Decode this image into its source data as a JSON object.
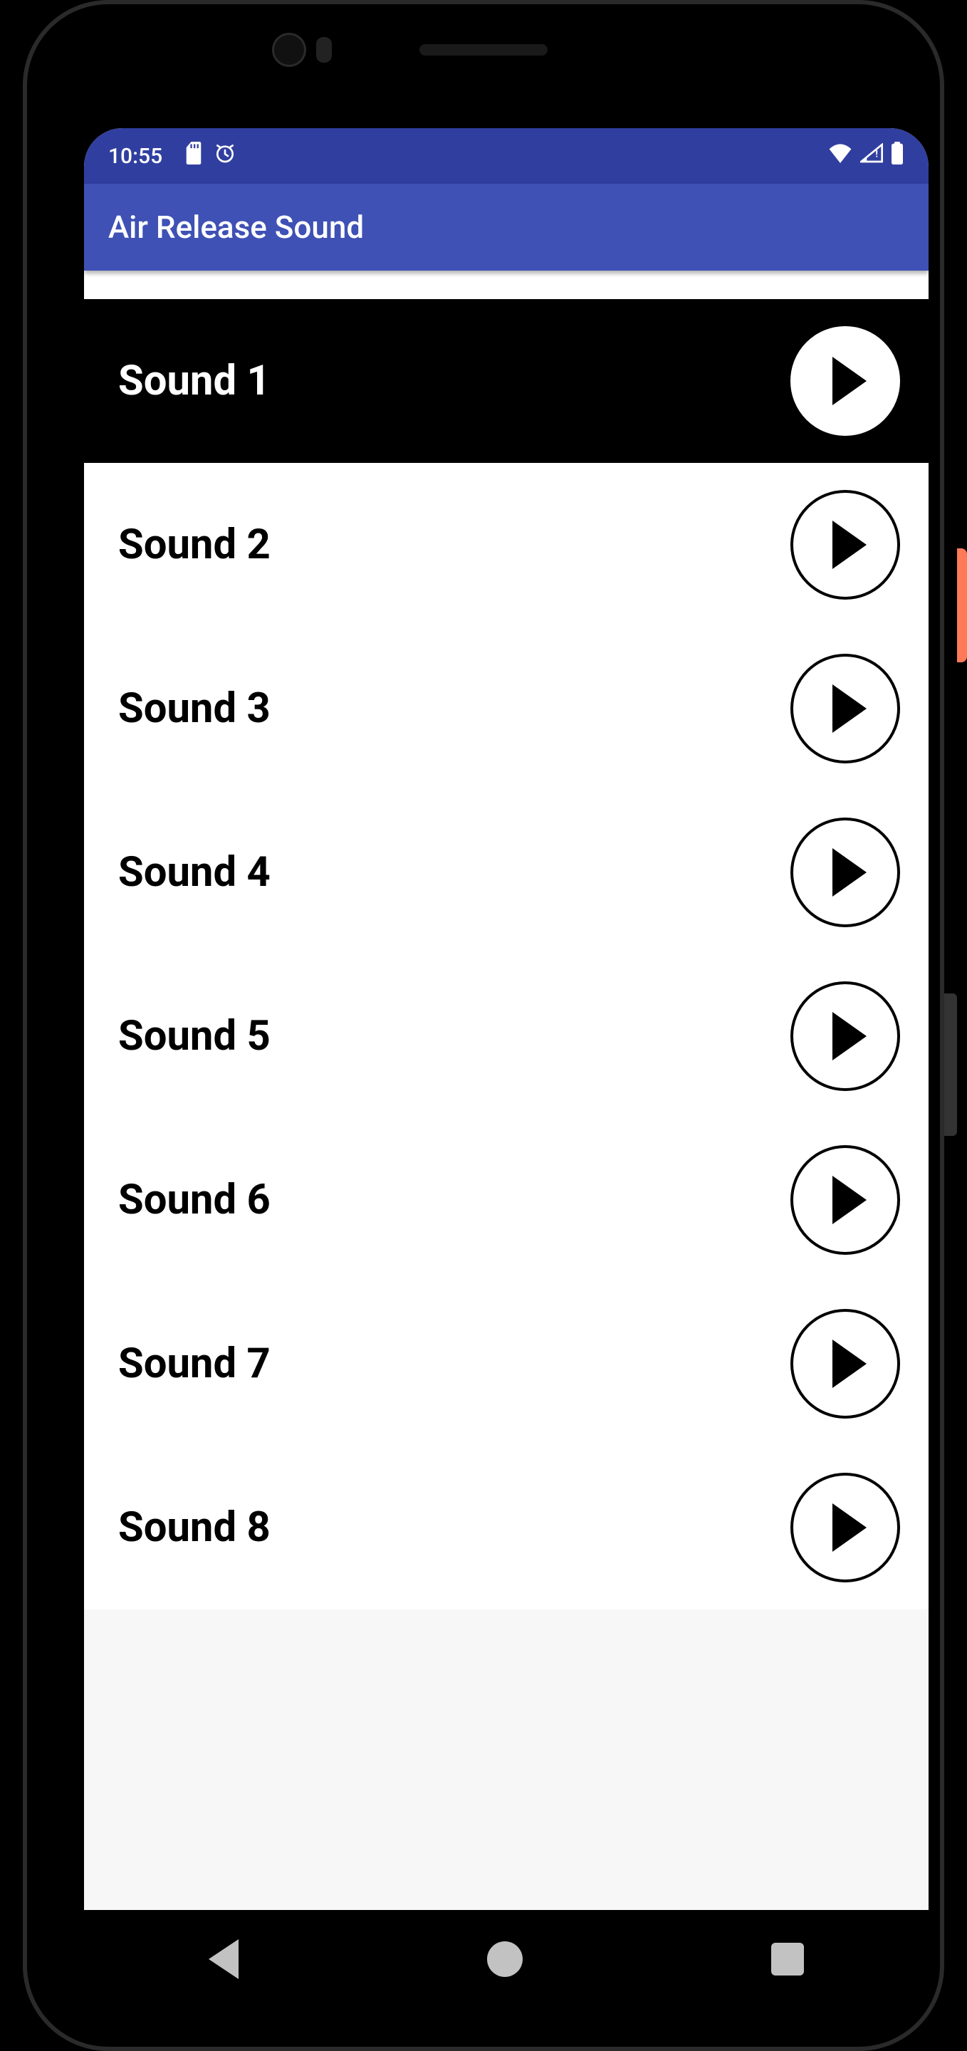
{
  "status": {
    "time": "10:55",
    "icons_left": [
      "sd-card-icon",
      "alarm-icon"
    ],
    "icons_right": [
      "wifi-icon",
      "signal-icon",
      "battery-icon"
    ]
  },
  "app_bar": {
    "title": "Air Release Sound"
  },
  "sounds": [
    {
      "label": "Sound 1",
      "selected": true
    },
    {
      "label": "Sound 2",
      "selected": false
    },
    {
      "label": "Sound 3",
      "selected": false
    },
    {
      "label": "Sound 4",
      "selected": false
    },
    {
      "label": "Sound 5",
      "selected": false
    },
    {
      "label": "Sound 6",
      "selected": false
    },
    {
      "label": "Sound 7",
      "selected": false
    },
    {
      "label": "Sound 8",
      "selected": false
    }
  ],
  "nav": {
    "back": "back",
    "home": "home",
    "recent": "recent"
  }
}
